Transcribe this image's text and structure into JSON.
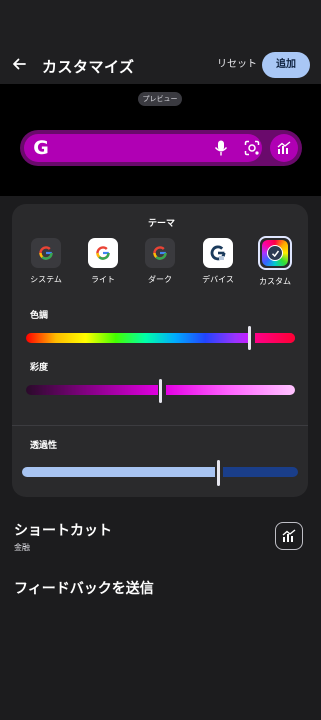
{
  "header": {
    "title": "カスタマイズ",
    "reset_label": "リセット",
    "add_label": "追加",
    "back_icon": "arrow-left-icon"
  },
  "preview": {
    "badge": "プレビュー",
    "logo_letter": "G",
    "bar_color": "#b000b4",
    "icons": [
      "mic-icon",
      "lens-icon",
      "shortcut-icon"
    ]
  },
  "theme": {
    "label": "テーマ",
    "items": [
      {
        "name": "システム",
        "letter": "G",
        "selected": false
      },
      {
        "name": "ライト",
        "letter": "G",
        "selected": false
      },
      {
        "name": "ダーク",
        "letter": "G",
        "selected": false
      },
      {
        "name": "デバイス",
        "letter": "G",
        "selected": false
      },
      {
        "name": "カスタム",
        "letter": "",
        "selected": true
      }
    ]
  },
  "hue": {
    "label": "色調",
    "value": 0.83
  },
  "saturation": {
    "label": "彩度",
    "value": 0.5
  },
  "transparency": {
    "label": "透過性",
    "value": 0.7
  },
  "shortcut": {
    "title": "ショートカット",
    "subtitle": "金融",
    "icon": "finance-chart-icon"
  },
  "feedback_label": "フィードバックを送信",
  "colors": {
    "accent": "#a9c7f5",
    "preview_purple": "#b000b4",
    "transparency_light": "#a8c4f2",
    "transparency_dark": "#1a3e8a"
  }
}
